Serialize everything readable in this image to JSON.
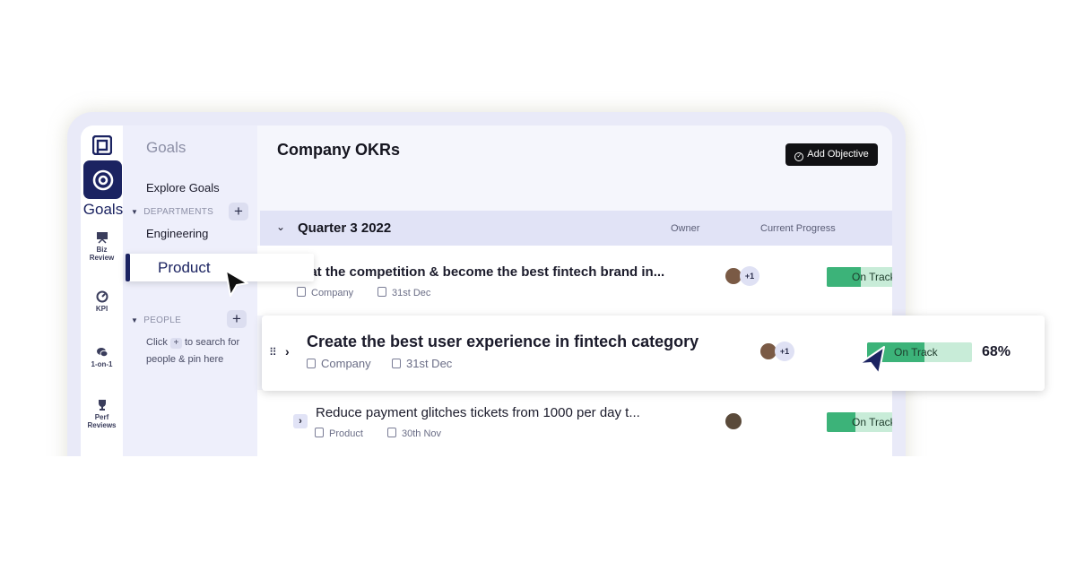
{
  "rail": {
    "active_label": "Goals",
    "items": [
      {
        "label_line1": "Biz",
        "label_line2": "Review",
        "icon": "presentation-icon"
      },
      {
        "label_line1": "KPI",
        "label_line2": "",
        "icon": "gauge-icon"
      },
      {
        "label_line1": "1-on-1",
        "label_line2": "",
        "icon": "chat-icon"
      },
      {
        "label_line1": "Perf",
        "label_line2": "Reviews",
        "icon": "trophy-icon"
      }
    ]
  },
  "panel": {
    "title": "Goals",
    "explore": "Explore Goals",
    "departments_label": "DEPARTMENTS",
    "department_items": [
      "Engineering",
      "Product"
    ],
    "people_label": "PEOPLE",
    "people_help_part1": "Click",
    "people_help_plus": "+",
    "people_help_part2": "to search for people & pin here"
  },
  "main": {
    "title": "Company OKRs",
    "add_button": "Add Objective",
    "quarter": "Quarter 3 2022",
    "col_owner": "Owner",
    "col_progress": "Current Progress"
  },
  "objectives": [
    {
      "title": "eat the competition & become the best fintech brand in...",
      "scope": "Company",
      "due": "31st Dec",
      "extra_owners": "+1",
      "status": "On Track",
      "progress": 0.55
    },
    {
      "title": "Create the best user experience in fintech category",
      "scope": "Company",
      "due": "31st Dec",
      "extra_owners": "+1",
      "status": "On Track",
      "progress": 0.55,
      "percent": "68%"
    },
    {
      "title": "Reduce payment glitches tickets from 1000 per day t...",
      "scope": "Product",
      "due": "30th Nov",
      "status": "On Track",
      "progress": 0.45
    }
  ],
  "colors": {
    "brand": "#1b2361",
    "on_track": "#3cb379",
    "on_track_bg": "#c8ecd8"
  }
}
